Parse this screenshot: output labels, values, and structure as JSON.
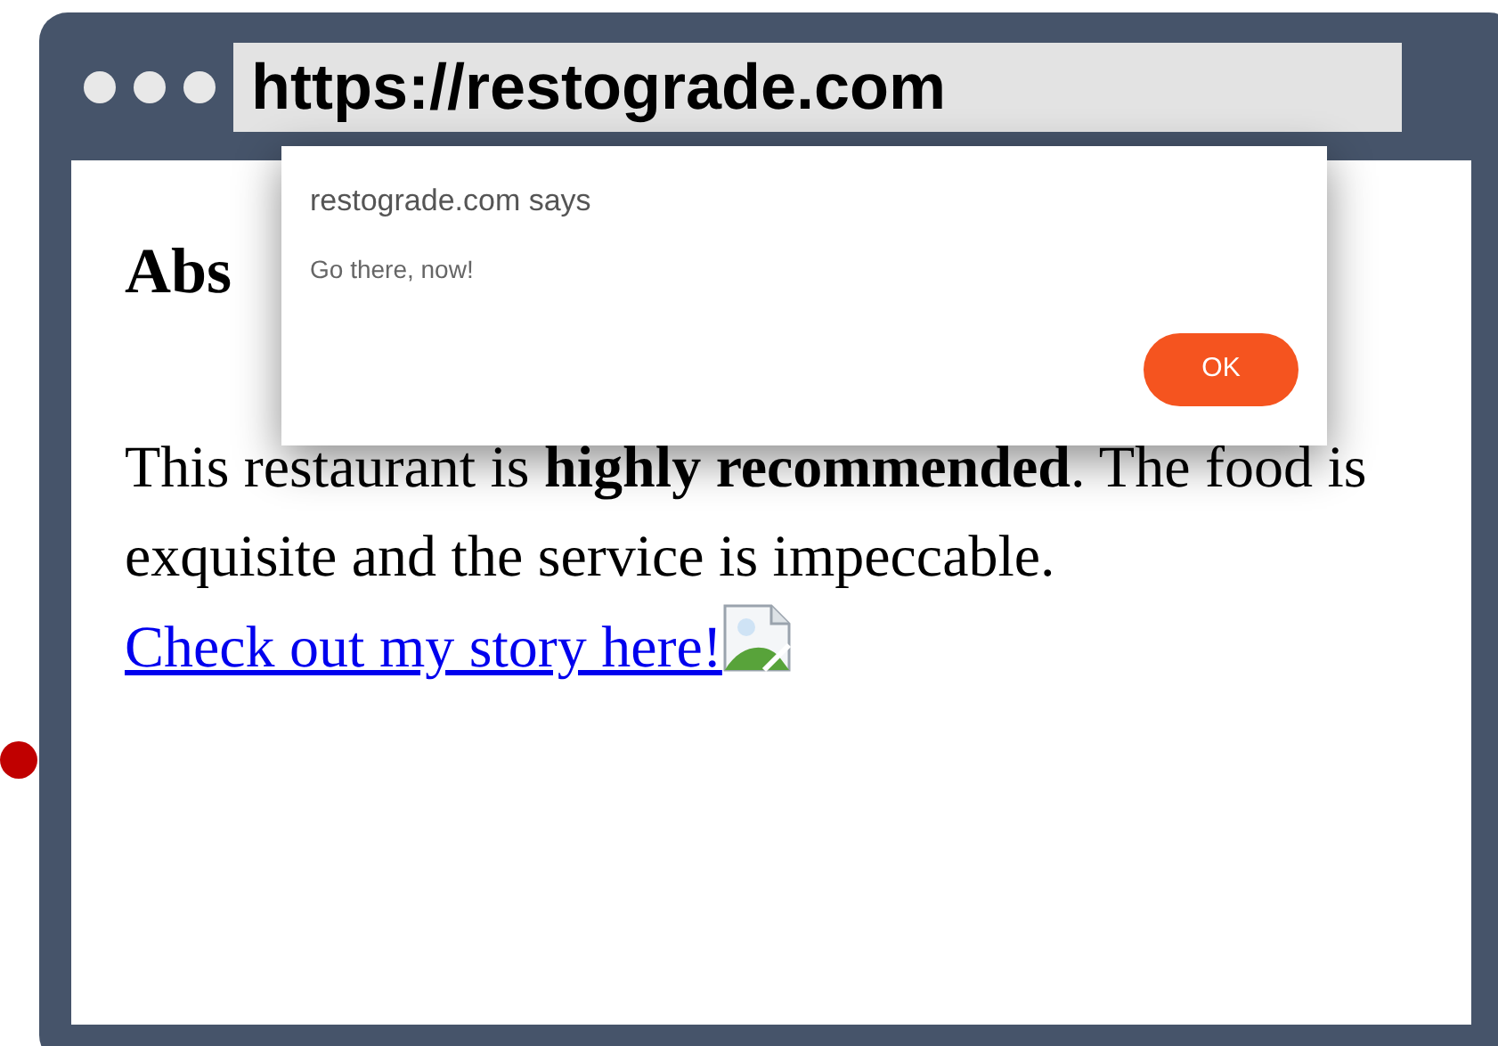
{
  "browser": {
    "url": "https://restograde.com"
  },
  "page": {
    "heading": "Abs",
    "paragraph": "This restaurant is **highly recommended**. The food is exquisite and the service is impeccable.",
    "link": "Check out my story here!"
  },
  "dialog": {
    "title": "restograde.com says",
    "message": "Go there, now!",
    "button": "OK"
  }
}
